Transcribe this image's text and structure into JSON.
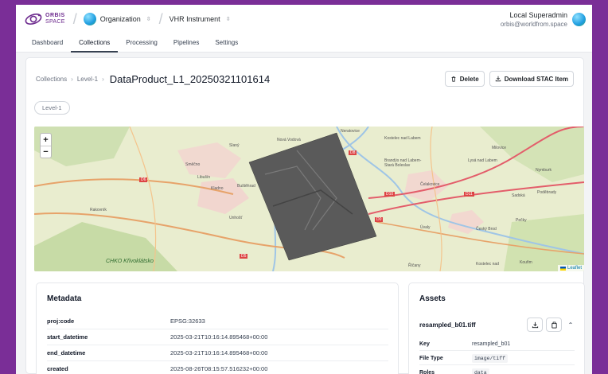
{
  "brand": {
    "line1": "ORBIS",
    "line2": "SPACE"
  },
  "selectors": {
    "organization": "Organization",
    "instrument": "VHR Instrument"
  },
  "user": {
    "name": "Local Superadmin",
    "email": "orbis@worldfrom.space"
  },
  "nav": {
    "items": [
      "Dashboard",
      "Collections",
      "Processing",
      "Pipelines",
      "Settings"
    ],
    "active": "Collections"
  },
  "breadcrumb": {
    "root": "Collections",
    "level": "Level-1",
    "title": "DataProduct_L1_20250321101614"
  },
  "actions": {
    "delete": "Delete",
    "download": "Download STAC Item"
  },
  "tag": "Level-1",
  "map": {
    "zoom_in": "+",
    "zoom_out": "−",
    "attribution": "Leaflet",
    "labels": [
      "CHKO Křivoklátsko",
      "Nová Vodová",
      "Slaný",
      "Směčno",
      "Libušín",
      "Kladno",
      "Buštěhrad",
      "Unhošť",
      "Rakovník",
      "Kostelec nad Labem",
      "Brandýs nad Labem-Stará Boleslav",
      "Čelakovice",
      "Lysá nad Labem",
      "Milovice",
      "Nymburk",
      "Poděbrady",
      "Sadská",
      "Pečky",
      "Úvaly",
      "Český Brod",
      "Kostelec nad",
      "Kouřim",
      "Říčany",
      "D5",
      "D6",
      "D8",
      "D10",
      "D11",
      "D0",
      "Neratovice"
    ]
  },
  "metadata": {
    "title": "Metadata",
    "rows": [
      {
        "key": "proj:code",
        "value": "EPSG:32633"
      },
      {
        "key": "start_datetime",
        "value": "2025-03-21T10:16:14.895468+00:00"
      },
      {
        "key": "end_datetime",
        "value": "2025-03-21T10:16:14.895468+00:00"
      },
      {
        "key": "created",
        "value": "2025-08-26T08:15:57.516232+00:00"
      }
    ]
  },
  "assets": {
    "title": "Assets",
    "item": {
      "name": "resampled_b01.tiff",
      "rows": [
        {
          "key": "Key",
          "value": "resampled_b01"
        },
        {
          "key": "File Type",
          "value": "image/tiff"
        },
        {
          "key": "Roles",
          "value": "data"
        }
      ]
    }
  },
  "colors": {
    "frame": "#7a2e97",
    "brand": "#6d2a8e",
    "active_tab": "#374151"
  },
  "icons": [
    "orbis-logo-icon",
    "organization-icon",
    "chevron-updown-icon",
    "user-avatar-icon",
    "trash-icon",
    "download-icon",
    "copy-icon",
    "chevron-up-icon"
  ]
}
